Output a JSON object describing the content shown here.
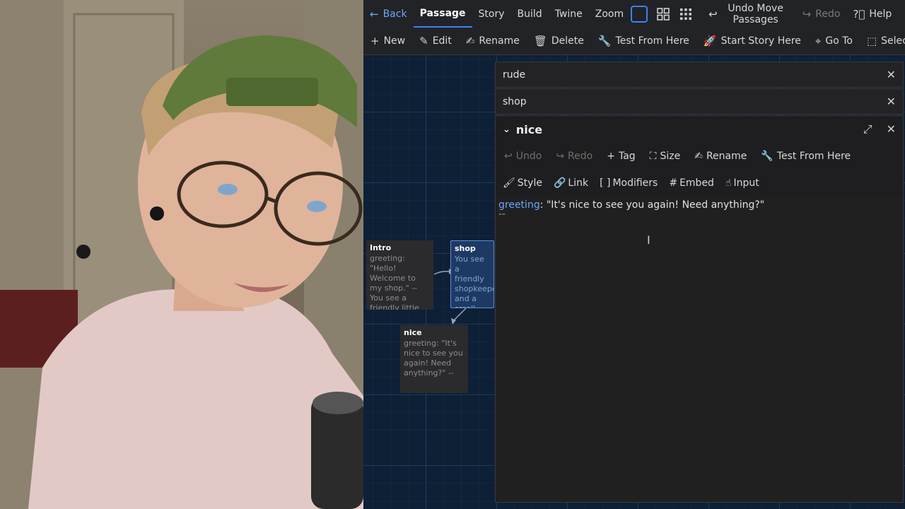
{
  "topbar": {
    "back": "Back",
    "tabs": [
      "Passage",
      "Story",
      "Build",
      "Twine"
    ],
    "zoom": "Zoom",
    "undo_move": "Undo Move\nPassages",
    "redo": "Redo",
    "help": "Help"
  },
  "toolbar": {
    "new": "New",
    "edit": "Edit",
    "rename": "Rename",
    "delete": "Delete",
    "test_from_here": "Test From Here",
    "start_story_here": "Start Story Here",
    "go_to": "Go To",
    "select_all": "Select All"
  },
  "passages": [
    {
      "title": "Intro",
      "excerpt": "greeting: \"Hello! Welcome to my shop.\" -- You see a friendly little shop in a",
      "selected": false
    },
    {
      "title": "shop",
      "excerpt": "You see a friendly shopkeeper and a small bell above your head and the",
      "selected": true
    },
    {
      "title": "nice",
      "excerpt": "greeting: \"It's nice to see you again! Need anything?\" --",
      "selected": false
    }
  ],
  "dialogs": {
    "collapsed": [
      "rude",
      "shop"
    ],
    "open": {
      "title": "nice",
      "row1": [
        "Undo",
        "Redo",
        "Tag",
        "Size",
        "Rename",
        "Test From Here"
      ],
      "row2": [
        "Style",
        "Link",
        "Modifiers",
        "Embed",
        "Input"
      ],
      "text_key": "greeting",
      "text_value": ": \"It's nice to see you again! Need anything?\"",
      "text_line2": "--"
    }
  },
  "colors": {
    "accent": "#3b82f6",
    "selected_passage": "#1e3a64",
    "map_bg": "#0e2036"
  }
}
